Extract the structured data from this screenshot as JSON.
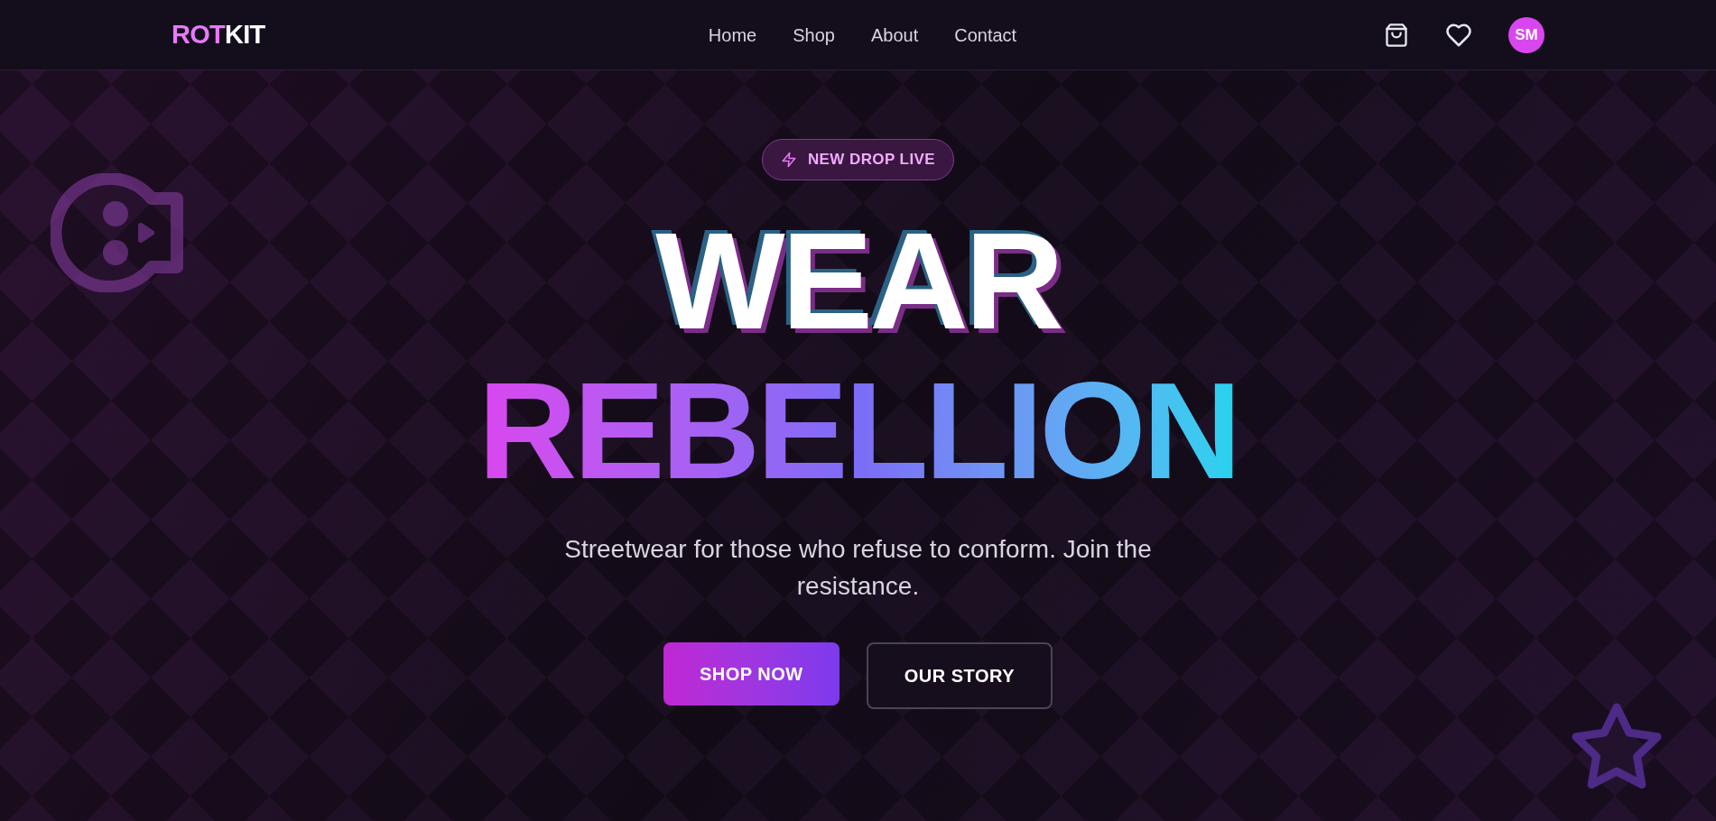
{
  "header": {
    "logo": {
      "accent": "ROT",
      "rest": "KIT"
    },
    "nav": [
      "Home",
      "Shop",
      "About",
      "Contact"
    ],
    "avatar": "SM"
  },
  "hero": {
    "badge": "NEW DROP LIVE",
    "headline": [
      "WEAR",
      "REBELLION"
    ],
    "subtitle": "Streetwear for those who refuse to conform. Join the resistance.",
    "buttons": [
      {
        "label": "SHOP NOW",
        "kind": "primary"
      },
      {
        "label": "OUR STORY",
        "kind": "outline"
      }
    ]
  }
}
